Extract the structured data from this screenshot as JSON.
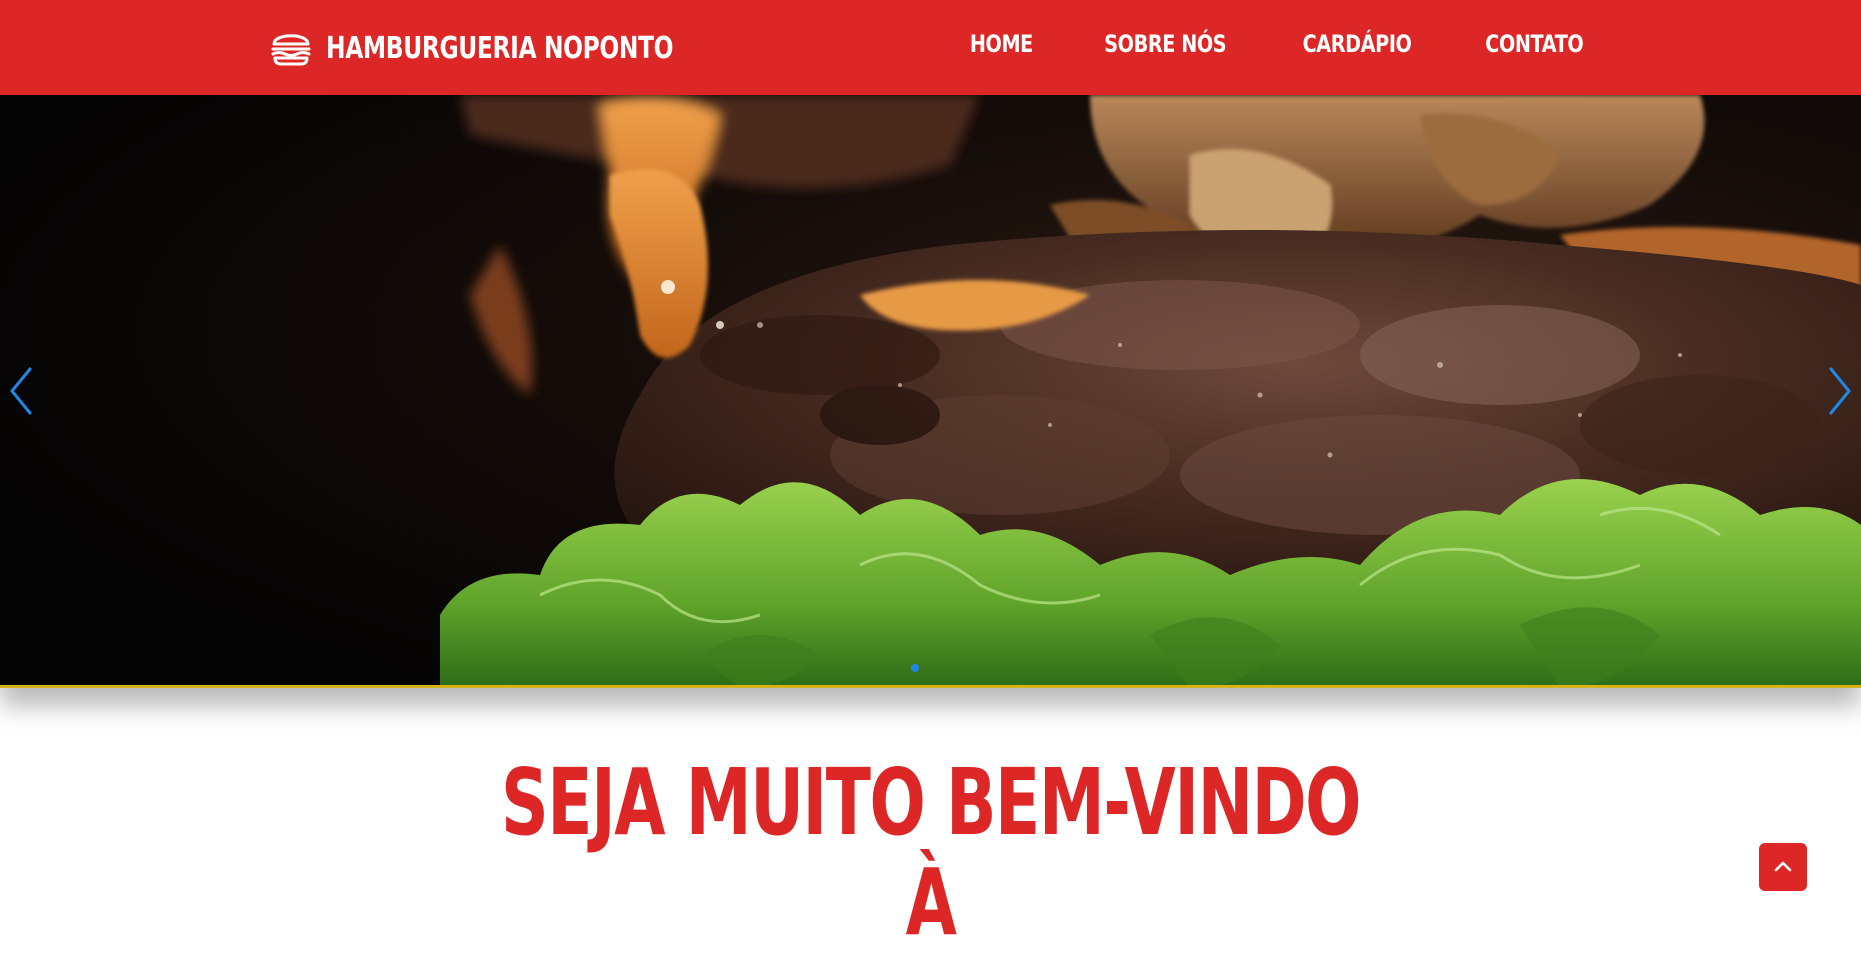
{
  "brand": {
    "name": "HAMBURGUERIA NOPONTO",
    "icon": "hamburger-icon"
  },
  "nav": {
    "items": [
      {
        "label": "HOME"
      },
      {
        "label": "SOBRE NÓS"
      },
      {
        "label": "CARDÁPIO"
      },
      {
        "label": "CONTATO"
      }
    ]
  },
  "carousel": {
    "prev_icon": "chevron-left-icon",
    "next_icon": "chevron-right-icon",
    "active_slide": 1,
    "slide_count": 1
  },
  "welcome": {
    "line1": "SEJA MUITO BEM-VINDO",
    "line2": "À"
  },
  "back_to_top": {
    "icon": "chevron-up-icon"
  },
  "colors": {
    "primary": "#dd2727",
    "accent_border": "#d6b21b",
    "carousel_control": "#1e88e5"
  }
}
